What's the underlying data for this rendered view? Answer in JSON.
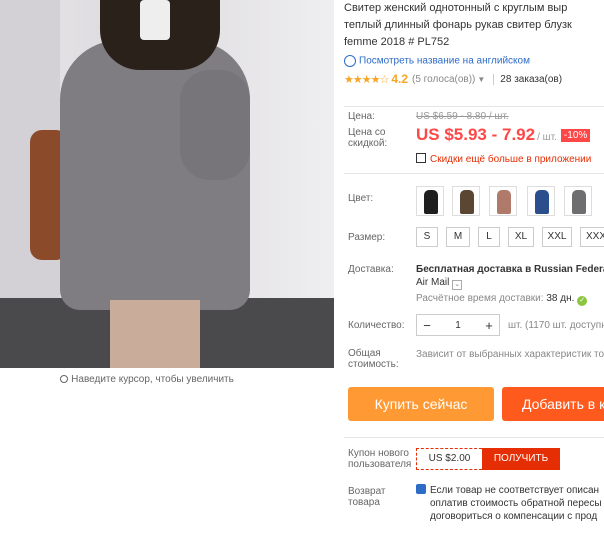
{
  "product": {
    "title_lines": [
      "Свитер женский однотонный с круглым выр",
      "теплый длинный фонарь рукав свитер блузк",
      "femme 2018 # PL752"
    ],
    "translate_link": "Посмотреть название на английском",
    "stars": "★★★★☆",
    "rating": "4.2",
    "votes": "(5 голоса(ов))",
    "orders": "28 заказа(ов)",
    "zoom_hint": "Наведите курсор, чтобы увеличить"
  },
  "price": {
    "label": "Цена:",
    "old_value": "US $6.59 - 8.80 / шт.",
    "discount_label": "Цена со скидкой:",
    "value": "US $5.93 - 7.92",
    "unit": "/ шт.",
    "discount_badge": "-10%",
    "app_discount": "Скидки ещё больше в приложении"
  },
  "color": {
    "label": "Цвет:",
    "swatches": [
      "#1f1f1f",
      "#5a4632",
      "#b07a6a",
      "#2b4f8c",
      "#6e6e70"
    ]
  },
  "size": {
    "label": "Размер:",
    "options": [
      "S",
      "M",
      "L",
      "XL",
      "XXL",
      "XXX"
    ]
  },
  "shipping": {
    "label": "Доставка:",
    "main": "Бесплатная доставка в Russian Federa",
    "carrier": "Air Mail",
    "eta_label": "Расчётное время доставки:",
    "eta_value": "38 дн."
  },
  "quantity": {
    "label": "Количество:",
    "value": "1",
    "available": "шт. (1170 шт. доступн"
  },
  "total": {
    "label": "Общая стоимость:",
    "value": "Зависит от выбранных характеристик то"
  },
  "buttons": {
    "buy_now": "Купить сейчас",
    "add_to_cart": "Добавить в к"
  },
  "coupon": {
    "label": "Купон нового пользователя",
    "amount": "US $2.00",
    "get": "ПОЛУЧИТЬ"
  },
  "returns": {
    "label": "Возврат товара",
    "lines": [
      "Если товар не соответствует описан",
      "оплатив стоимость обратной пересы",
      "договориться о компенсации с прод"
    ]
  }
}
